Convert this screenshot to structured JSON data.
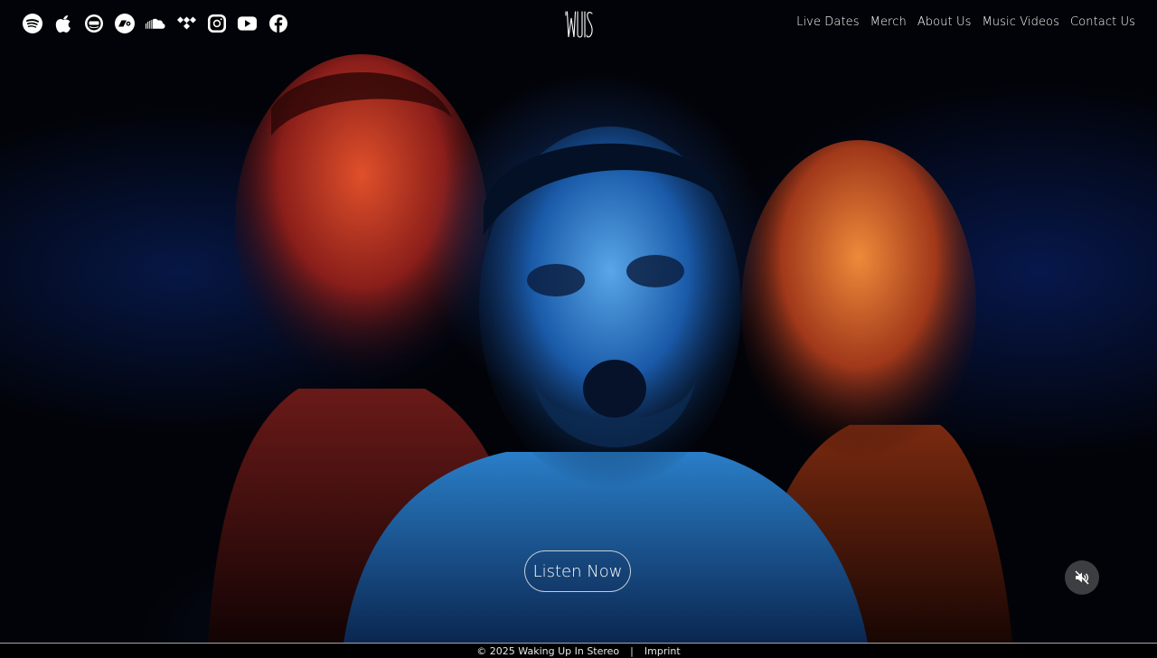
{
  "social": [
    {
      "name": "spotify-icon"
    },
    {
      "name": "apple-music-icon"
    },
    {
      "name": "amazon-music-icon"
    },
    {
      "name": "bandcamp-icon"
    },
    {
      "name": "soundcloud-icon"
    },
    {
      "name": "tidal-icon"
    },
    {
      "name": "instagram-icon"
    },
    {
      "name": "youtube-icon"
    },
    {
      "name": "facebook-icon"
    }
  ],
  "logo": {
    "text": "WUIS"
  },
  "nav": {
    "items": [
      "Live Dates",
      "Merch",
      "About Us",
      "Music Videos",
      "Contact Us"
    ]
  },
  "hero": {
    "cta_label": "Listen Now",
    "mute_icon": "speaker-muted-icon"
  },
  "footer": {
    "copyright": "© 2025 Waking Up In Stereo",
    "separator": "|",
    "imprint": "Imprint"
  },
  "colors": {
    "background": "#000000",
    "accent_blue": "#1a6fd0",
    "accent_red": "#c2361e",
    "accent_orange": "#d66a1e",
    "text": "#ffffff"
  }
}
